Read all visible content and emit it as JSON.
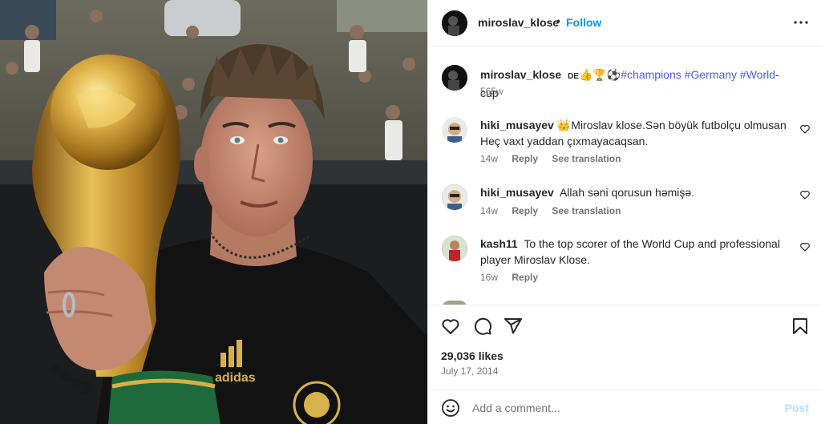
{
  "post": {
    "username": "miroslav_klose",
    "follow_label": "Follow",
    "dot": "•",
    "caption": {
      "username": "miroslav_klose",
      "flag": "DE",
      "emojis": "👍🏆⚽",
      "tags": [
        "#champions",
        "#Germany",
        "#World"
      ],
      "tail": "-cup",
      "time": "565w"
    },
    "comments": [
      {
        "username": "hiki_musayev",
        "emoji": "👑",
        "text": "Miroslav klose.Sən böyük futbolçu olmusan Heç vaxt yaddan çıxmayacaqsan.",
        "time": "14w",
        "reply": "Reply",
        "translate": "See translation"
      },
      {
        "username": "hiki_musayev",
        "emoji": "",
        "text": "Allah səni qorusun həmişə.",
        "time": "14w",
        "reply": "Reply",
        "translate": "See translation"
      },
      {
        "username": "kash11",
        "emoji": "",
        "text": "To the top scorer of the World Cup and professional player Miroslav Klose.",
        "time": "16w",
        "reply": "Reply",
        "translate": ""
      }
    ],
    "likes": "29,036 likes",
    "date": "July 17, 2014",
    "add_comment": {
      "placeholder": "Add a comment...",
      "post_label": "Post"
    }
  },
  "icons": {
    "more": "more-options-icon",
    "like": "heart-icon",
    "comment": "comment-bubble-icon",
    "share": "paper-plane-icon",
    "save": "bookmark-icon",
    "emoji": "smiley-icon"
  },
  "colors": {
    "accent": "#0095f6",
    "hashtag": "#00376b",
    "muted": "#737373",
    "post_disabled": "#b2dffc"
  }
}
